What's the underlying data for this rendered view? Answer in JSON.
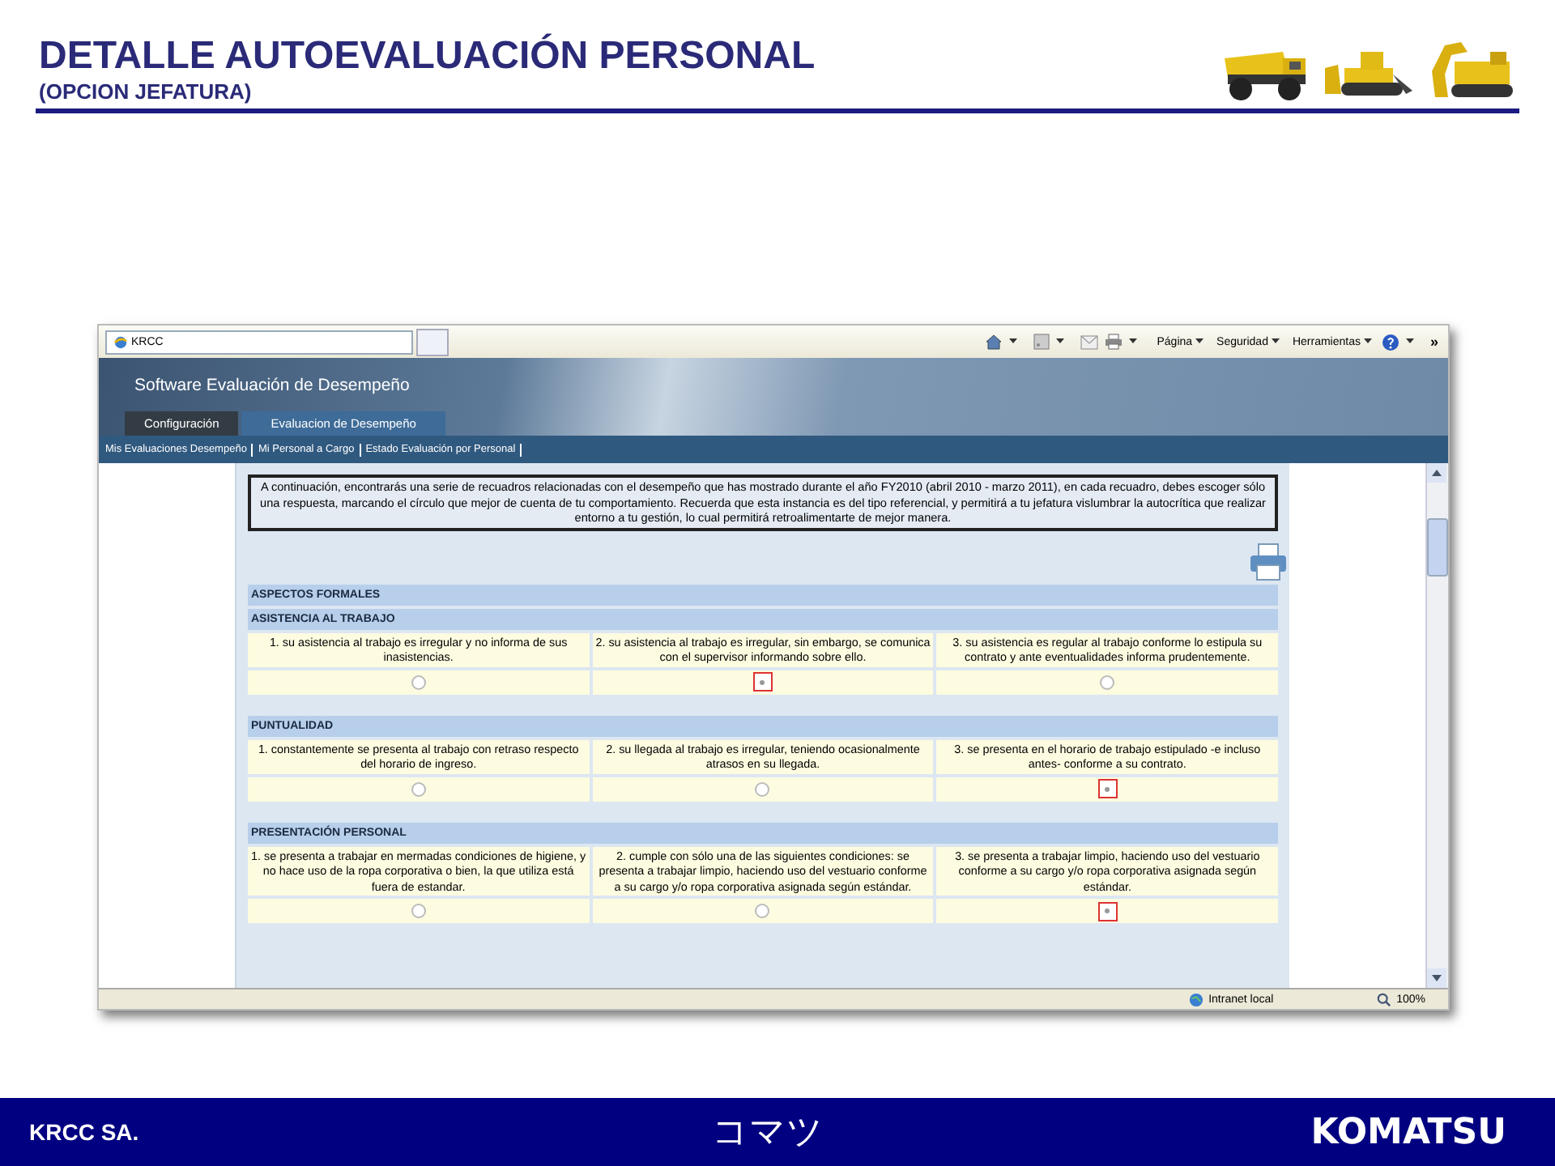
{
  "slide": {
    "title": "DETALLE AUTOEVALUACIÓN PERSONAL",
    "subtitle": "(OPCION JEFATURA)"
  },
  "browser": {
    "tab_title": "KRCC",
    "menus": [
      "Página",
      "Seguridad",
      "Herramientas"
    ],
    "more": "»"
  },
  "app": {
    "title": "Software Evaluación de Desempeño",
    "tabs": [
      {
        "label": "Configuración",
        "selected": false
      },
      {
        "label": "Evaluacion de Desempeño",
        "selected": true
      }
    ],
    "links": [
      "Mis Evaluaciones Desempeño",
      "Mi Personal a Cargo",
      "Estado Evaluación por Personal"
    ]
  },
  "intro": "A continuación, encontrarás una serie de recuadros relacionadas con el desempeño que has mostrado durante el año FY2010 (abril 2010 - marzo 2011), en cada recuadro, debes escoger sólo una respuesta, marcando el círculo que mejor de cuenta de tu comportamiento. Recuerda que esta instancia es del tipo referencial, y permitirá a tu jefatura vislumbrar la autocrítica que realizar entorno a tu gestión, lo cual permitirá retroalimentarte de mejor manera.",
  "section": "ASPECTOS FORMALES",
  "criteria": [
    {
      "title": "ASISTENCIA AL TRABAJO",
      "options": [
        {
          "text": "1. su asistencia al trabajo es irregular y no informa de sus inasistencias.",
          "selected": false
        },
        {
          "text": "2. su asistencia al trabajo es irregular, sin embargo, se comunica con el supervisor informando sobre ello.",
          "selected": true
        },
        {
          "text": "3. su asistencia es regular al trabajo conforme lo estipula su contrato y ante eventualidades informa prudentemente.",
          "selected": false
        }
      ]
    },
    {
      "title": "PUNTUALIDAD",
      "options": [
        {
          "text": "1. constantemente se presenta al trabajo con retraso respecto del horario de ingreso.",
          "selected": false
        },
        {
          "text": "2. su llegada al trabajo es irregular, teniendo ocasionalmente atrasos en su llegada.",
          "selected": false
        },
        {
          "text": "3. se presenta en el horario de trabajo estipulado -e incluso antes- conforme a su contrato.",
          "selected": true
        }
      ]
    },
    {
      "title": "PRESENTACIÓN PERSONAL",
      "options": [
        {
          "text": "1. se presenta a trabajar en mermadas condiciones de higiene, y no hace uso de la ropa corporativa o bien, la que utiliza está fuera de estandar.",
          "selected": false
        },
        {
          "text": "2. cumple con sólo una de las siguientes condiciones: se presenta a trabajar limpio, haciendo uso del vestuario conforme a su cargo y/o ropa corporativa asignada según estándar.",
          "selected": false
        },
        {
          "text": "3. se presenta a trabajar limpio, haciendo uso del vestuario conforme a su cargo y/o ropa corporativa asignada según estándar.",
          "selected": true
        }
      ]
    }
  ],
  "status_bar": {
    "zone": "Intranet local",
    "zoom": "100%"
  },
  "footer": {
    "company": "KRCC SA.",
    "katakana": "コマツ",
    "logo": "KOMATSU"
  }
}
